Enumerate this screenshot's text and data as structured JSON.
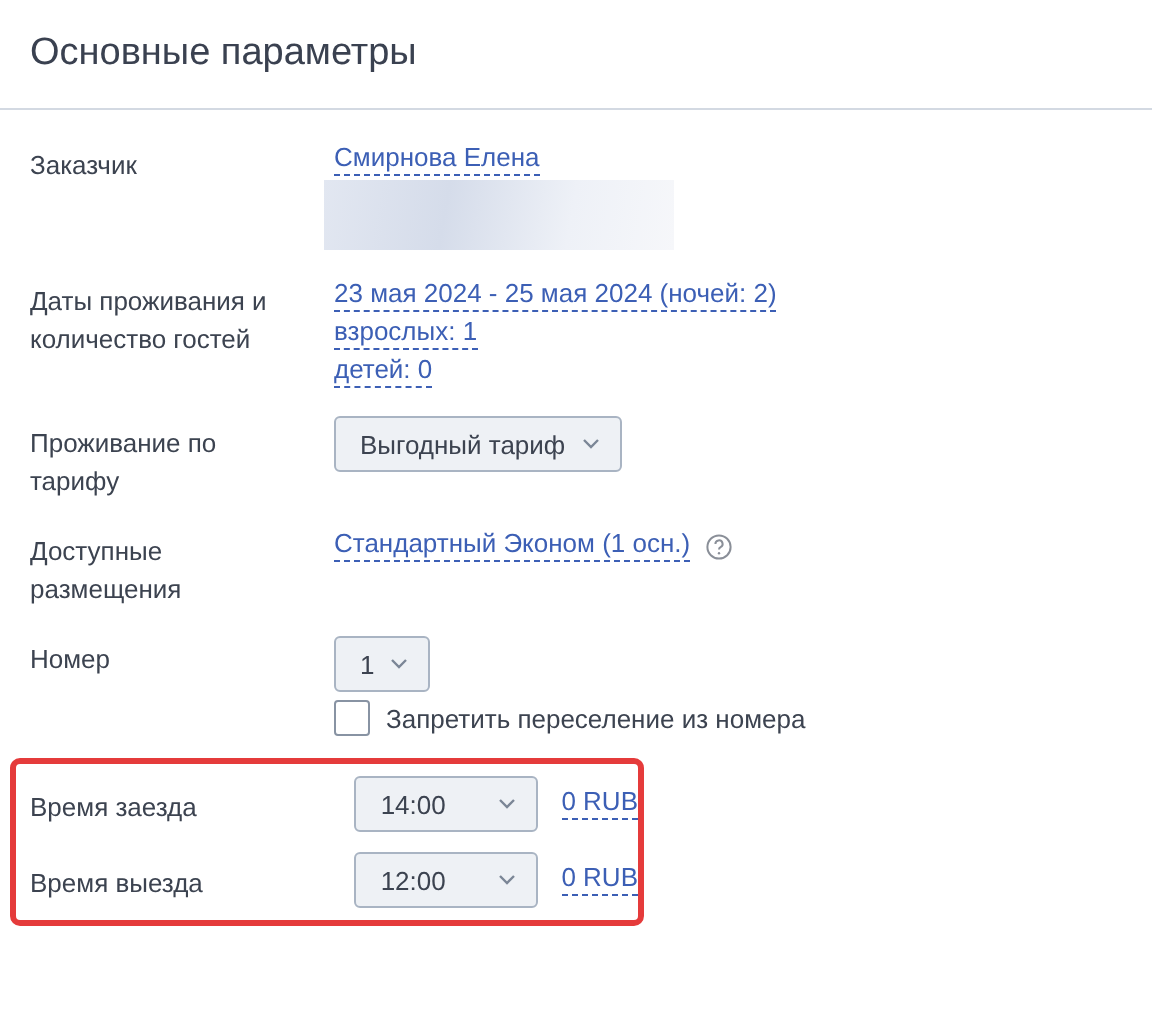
{
  "title": "Основные параметры",
  "rows": [
    {
      "kind": "links",
      "label": "Заказчик",
      "links": [
        "Смирнова Елена"
      ],
      "redacted": true
    },
    {
      "kind": "links",
      "label": "Даты проживания и количество гостей",
      "links": [
        "23 мая 2024 - 25 мая 2024 (ночей: 2)",
        "взрослых: 1",
        "детей: 0"
      ]
    },
    {
      "kind": "select",
      "label": "Проживание по тарифу",
      "value": "Выгодный тариф"
    },
    {
      "kind": "help_link",
      "label": "Доступные размещения",
      "links": [
        "Стандартный Эконом (1 осн.)"
      ]
    },
    {
      "kind": "select_checkbox",
      "label": "Номер",
      "value": "1",
      "checkbox": {
        "label": "Запретить переселение из номера",
        "checked": false
      }
    }
  ],
  "times": {
    "highlighted": true,
    "rows": [
      {
        "label": "Время заезда",
        "value": "14:00",
        "price": "0 RUB"
      },
      {
        "label": "Время выезда",
        "value": "12:00",
        "price": "0 RUB"
      }
    ]
  }
}
